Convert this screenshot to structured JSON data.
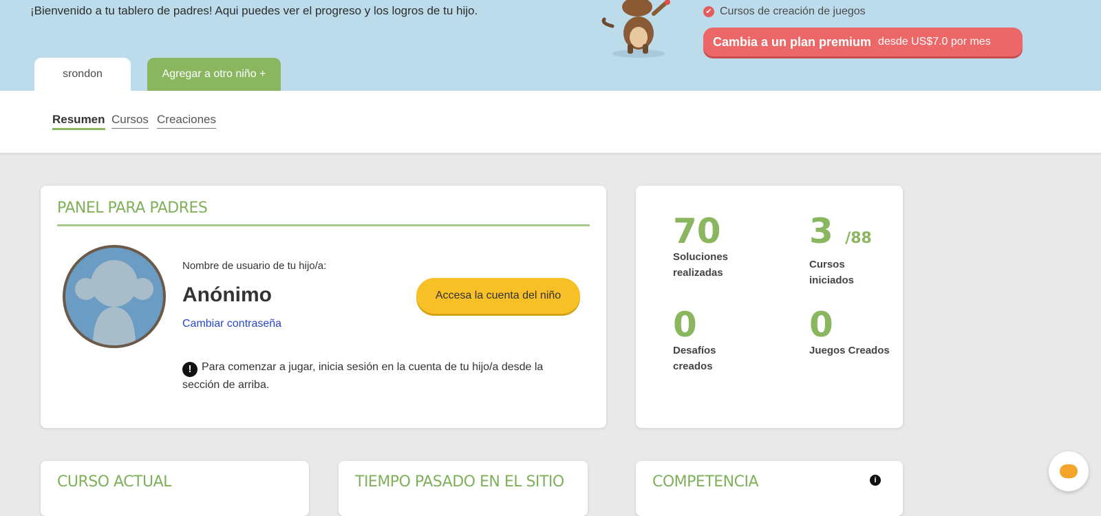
{
  "banner": {
    "welcome": "¡Bienvenido a tu tablero de padres! Aqui puedes ver el progreso y los logros de tu hijo.",
    "feature": "Cursos de creación de juegos",
    "premium_main": "Cambia a un plan premium",
    "premium_sub": "desde US$7.0 por mes"
  },
  "tabs": {
    "active": "srondon",
    "add": "Agregar a otro niño +"
  },
  "subnav": {
    "items": [
      "Resumen",
      "Cursos",
      "Creaciones"
    ]
  },
  "panel": {
    "title": "PANEL PARA PADRES",
    "user_label": "Nombre de usuario de tu hijo/a:",
    "username": "Anónimo",
    "change_password": "Cambiar contraseña",
    "access_button": "Accesa la cuenta del niño",
    "notice": "Para comenzar a jugar, inicia sesión en la cuenta de tu hijo/a desde la sección de arriba."
  },
  "stats": {
    "solutions": {
      "value": "70",
      "label": "Soluciones realizadas"
    },
    "courses": {
      "value": "3",
      "total": "/88",
      "label": "Cursos iniciados"
    },
    "challenges": {
      "value": "0",
      "label": "Desafíos creados"
    },
    "games": {
      "value": "0",
      "label": "Juegos Creados"
    }
  },
  "sections": {
    "current_course": "CURSO ACTUAL",
    "time_spent": "TIEMPO PASADO EN EL SITIO",
    "competence": "COMPETENCIA"
  },
  "colors": {
    "accent_green": "#8ab660",
    "premium_red": "#ec6767",
    "button_yellow": "#f7c027",
    "banner_blue": "#bcdcec"
  },
  "icons": [
    "monkey-mascot-icon",
    "check-circle-icon",
    "exclamation-icon",
    "info-icon",
    "chat-icon"
  ]
}
